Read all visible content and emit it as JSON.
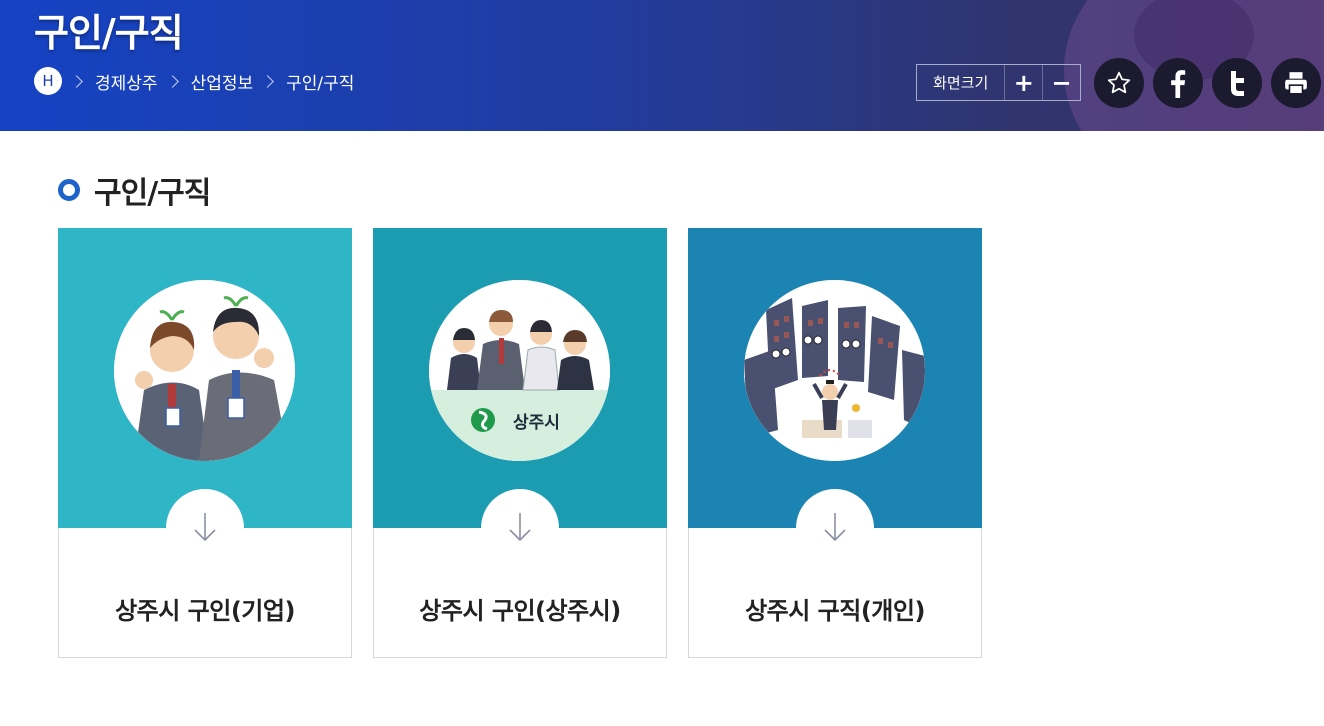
{
  "header": {
    "title": "구인/구직",
    "home_label": "H",
    "breadcrumb": [
      "경제상주",
      "산업정보",
      "구인/구직"
    ],
    "zoom": {
      "label": "화면크기",
      "plus": "+",
      "minus": "−"
    },
    "share_buttons": [
      "star-icon",
      "facebook-icon",
      "twitter-icon",
      "print-icon"
    ],
    "colors": {
      "banner_start": "#1543c4",
      "banner_end": "#3b2f66"
    }
  },
  "main": {
    "section_title": "구인/구직",
    "cards": [
      {
        "label": "상주시 구인(기업)",
        "color": "#2eb5c6",
        "icon": "job-seekers-illustration"
      },
      {
        "label": "상주시 구인(상주시)",
        "color": "#1b9cb1",
        "icon": "sangju-city-workers-illustration",
        "logo_text": "상주시"
      },
      {
        "label": "상주시 구직(개인)",
        "color": "#1b84b2",
        "icon": "buildings-graduate-illustration"
      }
    ]
  }
}
